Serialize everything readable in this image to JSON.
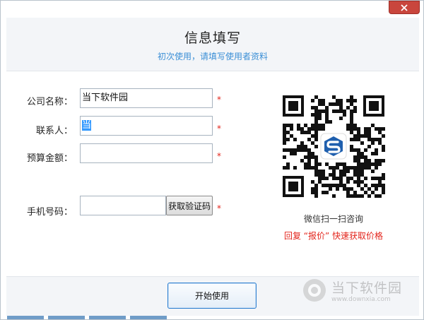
{
  "header": {
    "title": "信息填写",
    "subtitle": "初次使用，请填写使用者资料"
  },
  "form": {
    "company": {
      "label": "公司名称：",
      "value": "当下软件园"
    },
    "contact": {
      "label": "联系人：",
      "value": "当"
    },
    "budget": {
      "label": "预算金额：",
      "value": ""
    },
    "phone": {
      "label": "手机号码：",
      "value": ""
    },
    "required_mark": "*",
    "get_code_label": "获取验证码"
  },
  "qr": {
    "caption": "微信扫一扫咨询",
    "promo_prefix": "回复",
    "promo_keyword": "“报价”",
    "promo_suffix": "快速获取价格"
  },
  "footer": {
    "start_label": "开始使用"
  },
  "watermark": {
    "name": "当下软件园",
    "url": "www.downxia.com"
  },
  "colors": {
    "accent": "#3b8fd6",
    "required": "#e3241b",
    "close": "#c9463d",
    "button_border": "#2c7fd0"
  }
}
